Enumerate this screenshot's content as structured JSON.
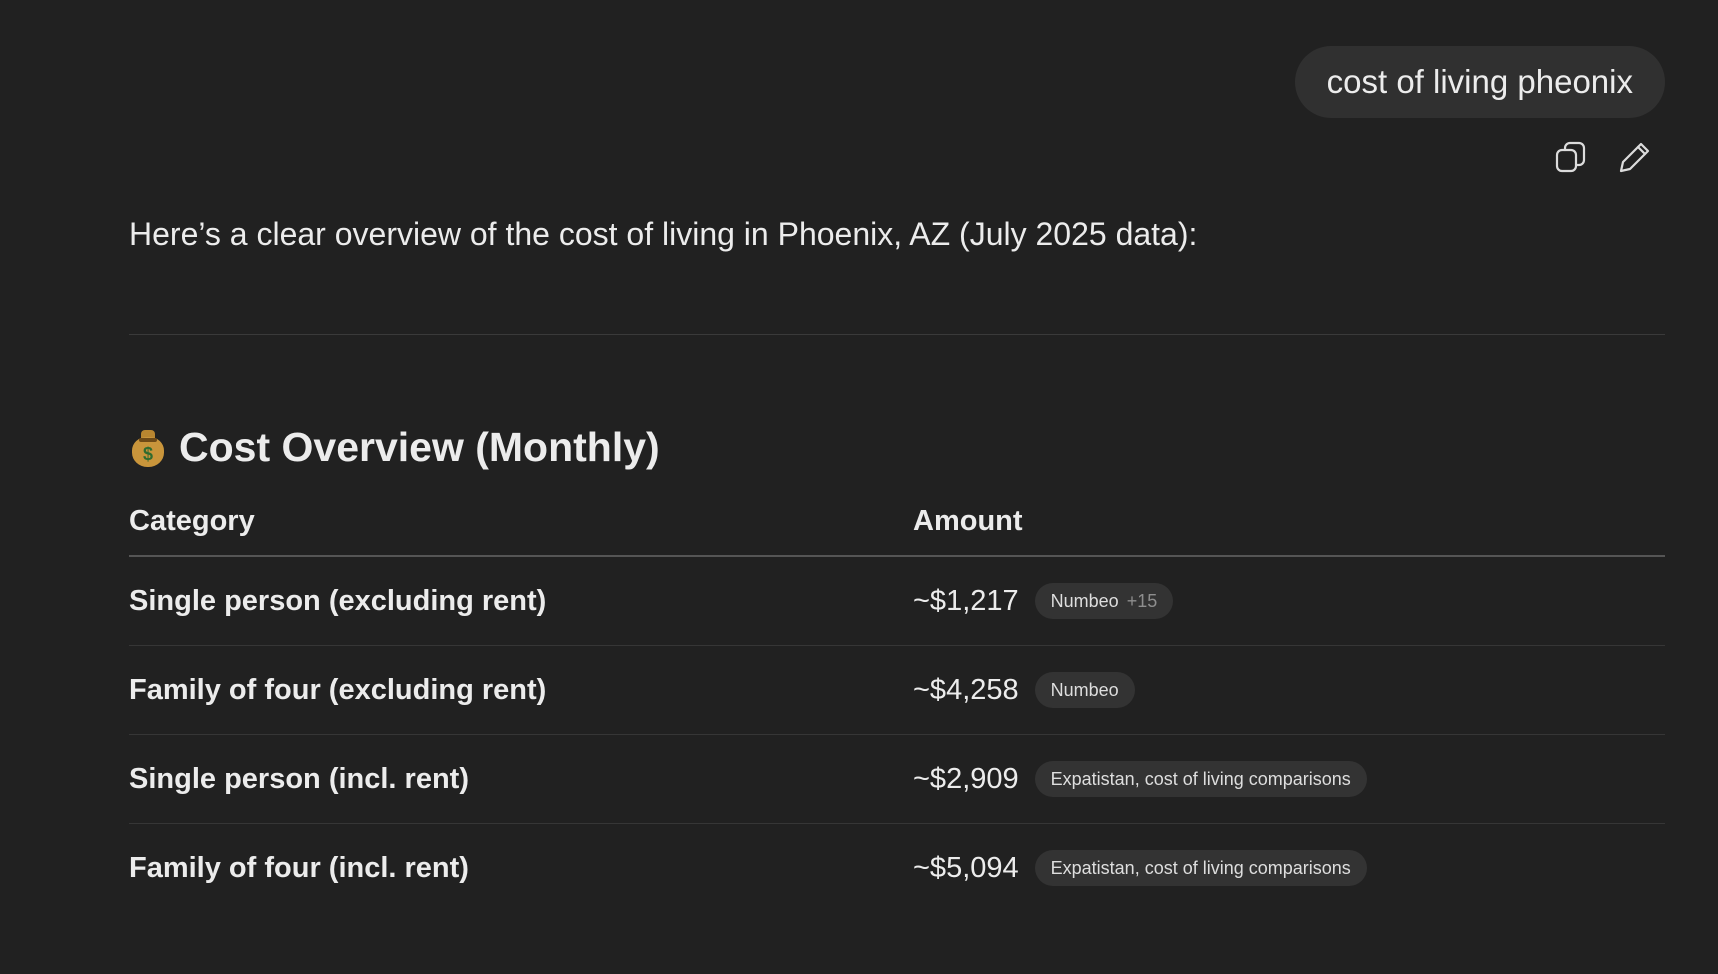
{
  "user_message": {
    "text": "cost of living pheonix"
  },
  "message_actions": {
    "copy_icon": "copy-icon",
    "edit_icon": "pencil-icon"
  },
  "response": {
    "intro": "Here’s a clear overview of the cost of living in Phoenix, AZ (July 2025 data):",
    "section_heading": "Cost Overview (Monthly)",
    "section_emoji": "money-bag",
    "table": {
      "headers": [
        "Category",
        "Amount"
      ],
      "rows": [
        {
          "category": "Single person (excluding rent)",
          "amount": "~$1,217",
          "source": "Numbeo",
          "source_extra": "+15"
        },
        {
          "category": "Family of four (excluding rent)",
          "amount": "~$4,258",
          "source": "Numbeo",
          "source_extra": ""
        },
        {
          "category": "Single person (incl. rent)",
          "amount": "~$2,909",
          "source": "Expatistan, cost of living comparisons",
          "source_extra": ""
        },
        {
          "category": "Family of four (incl. rent)",
          "amount": "~$5,094",
          "source": "Expatistan, cost of living comparisons",
          "source_extra": ""
        }
      ]
    }
  },
  "colors": {
    "background": "#212121",
    "bubble": "#303030",
    "pill": "#333333",
    "text": "#ececec"
  }
}
